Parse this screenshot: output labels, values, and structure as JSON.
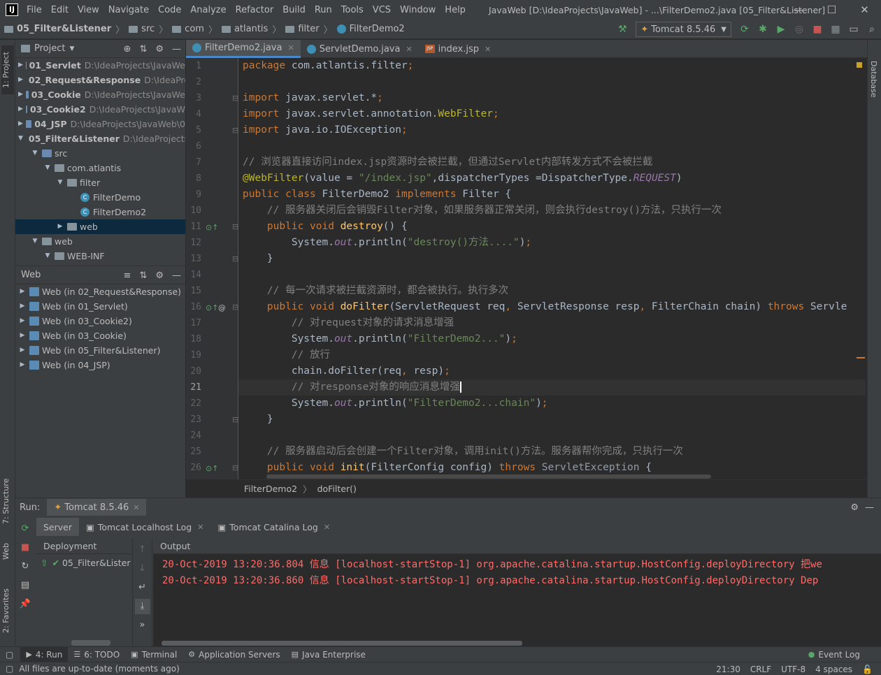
{
  "window": {
    "menu": [
      "File",
      "Edit",
      "View",
      "Navigate",
      "Code",
      "Analyze",
      "Refactor",
      "Build",
      "Run",
      "Tools",
      "VCS",
      "Window",
      "Help"
    ],
    "title": "JavaWeb [D:\\IdeaProjects\\JavaWeb] - ...\\FilterDemo2.java [05_Filter&Listener]"
  },
  "navbar": {
    "crumbs": [
      "05_Filter&Listener",
      "src",
      "com",
      "atlantis",
      "filter",
      "FilterDemo2"
    ],
    "run_config": "Tomcat 8.5.46"
  },
  "project_panel": {
    "title": "Project",
    "items": [
      {
        "name": "01_Servlet",
        "path": "D:\\IdeaProjects\\JavaWe",
        "depth": 0,
        "expanded": false
      },
      {
        "name": "02_Request&Response",
        "path": "D:\\IdeaPro",
        "depth": 0,
        "expanded": false
      },
      {
        "name": "03_Cookie",
        "path": "D:\\IdeaProjects\\JavaWe",
        "depth": 0,
        "expanded": false
      },
      {
        "name": "03_Cookie2",
        "path": "D:\\IdeaProjects\\JavaW",
        "depth": 0,
        "expanded": false
      },
      {
        "name": "04_JSP",
        "path": "D:\\IdeaProjects\\JavaWeb\\0",
        "depth": 0,
        "expanded": false
      },
      {
        "name": "05_Filter&Listener",
        "path": "D:\\IdeaProjects",
        "depth": 0,
        "expanded": true
      },
      {
        "name": "src",
        "path": "",
        "depth": 1,
        "expanded": true
      },
      {
        "name": "com.atlantis",
        "path": "",
        "depth": 2,
        "expanded": true
      },
      {
        "name": "filter",
        "path": "",
        "depth": 3,
        "expanded": true
      },
      {
        "name": "FilterDemo",
        "path": "",
        "depth": 4,
        "expanded": null
      },
      {
        "name": "FilterDemo2",
        "path": "",
        "depth": 4,
        "expanded": null
      },
      {
        "name": "web",
        "path": "",
        "depth": 3,
        "expanded": false
      },
      {
        "name": "web",
        "path": "",
        "depth": 1,
        "expanded": true
      },
      {
        "name": "WEB-INF",
        "path": "",
        "depth": 2,
        "expanded": true
      }
    ]
  },
  "web_panel": {
    "title": "Web",
    "items": [
      "Web (in 02_Request&Response)",
      "Web (in 01_Servlet)",
      "Web (in 03_Cookie2)",
      "Web (in 03_Cookie)",
      "Web (in 05_Filter&Listener)",
      "Web (in 04_JSP)"
    ]
  },
  "editor_tabs": [
    {
      "label": "FilterDemo2.java",
      "active": true
    },
    {
      "label": "ServletDemo.java",
      "active": false
    },
    {
      "label": "index.jsp",
      "active": false
    }
  ],
  "editor": {
    "current_line": 21,
    "breadcrumb": [
      "FilterDemo2",
      "doFilter()"
    ]
  },
  "run_window": {
    "label": "Run:",
    "config_tab": "Tomcat 8.5.46",
    "tabs": [
      "Server",
      "Tomcat Localhost Log",
      "Tomcat Catalina Log"
    ],
    "deployment_header": "Deployment",
    "output_header": "Output",
    "deployment_item": "05_Filter&Lister",
    "output_lines": [
      "20-Oct-2019 13:20:36.804 信息 [localhost-startStop-1] org.apache.catalina.startup.HostConfig.deployDirectory 把we",
      "20-Oct-2019 13:20:36.860 信息 [localhost-startStop-1] org.apache.catalina.startup.HostConfig.deployDirectory Dep"
    ]
  },
  "left_stripe": [
    "1: Project",
    "7: Structure",
    "Web",
    "2: Favorites"
  ],
  "right_stripe": [
    "Database"
  ],
  "tool_buttons": [
    {
      "label": "4: Run",
      "active": true
    },
    {
      "label": "6: TODO",
      "active": false
    },
    {
      "label": "Terminal",
      "active": false
    },
    {
      "label": "Application Servers",
      "active": false
    },
    {
      "label": "Java Enterprise",
      "active": false
    }
  ],
  "event_log": "Event Log",
  "status": {
    "message": "All files are up-to-date (moments ago)",
    "position": "21:30",
    "line_sep": "CRLF",
    "encoding": "UTF-8",
    "indent": "4 spaces"
  }
}
